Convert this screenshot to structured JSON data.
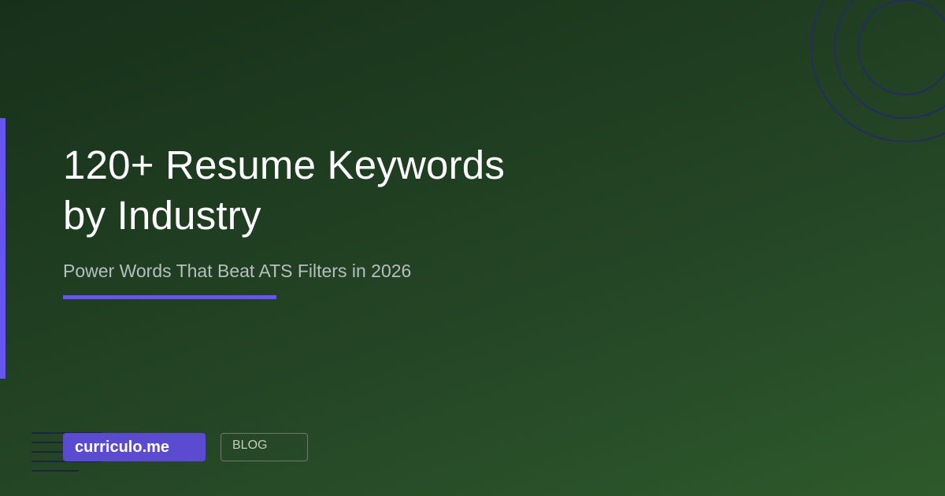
{
  "header": {
    "title_line1": "120+ Resume Keywords",
    "title_line2": "by Industry",
    "subtitle": "Power Words That Beat ATS Filters in 2026"
  },
  "footer": {
    "brand_label": "curriculo.me",
    "tag_label": "BLOG"
  },
  "colors": {
    "background_start": "#17301a",
    "background_end": "#2d5a2b",
    "accent": "#6655ee",
    "brand_badge": "#5b4bd0",
    "ring_stroke": "#262a63",
    "title_text": "#ffffff",
    "subtitle_text": "#b7bec0"
  }
}
